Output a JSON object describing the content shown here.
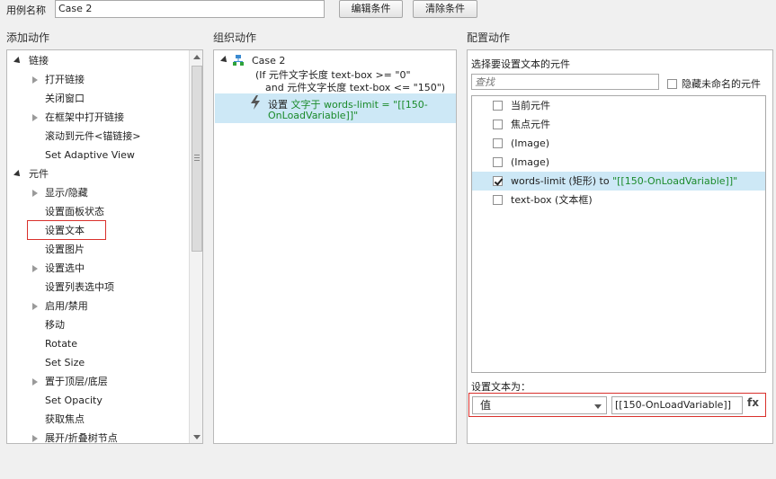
{
  "top": {
    "case_name_label": "用例名称",
    "case_name_value": "Case 2",
    "edit_condition_button": "编辑条件",
    "clear_condition_button": "清除条件"
  },
  "left": {
    "title": "添加动作",
    "items": [
      {
        "label": "链接",
        "kind": "group"
      },
      {
        "label": "打开链接",
        "kind": "sub"
      },
      {
        "label": "关闭窗口",
        "kind": "leaf"
      },
      {
        "label": "在框架中打开链接",
        "kind": "sub"
      },
      {
        "label": "滚动到元件<锚链接>",
        "kind": "leaf"
      },
      {
        "label": "Set Adaptive View",
        "kind": "leaf"
      },
      {
        "label": "元件",
        "kind": "group"
      },
      {
        "label": "显示/隐藏",
        "kind": "sub"
      },
      {
        "label": "设置面板状态",
        "kind": "leaf"
      },
      {
        "label": "设置文本",
        "kind": "leaf",
        "selected": true
      },
      {
        "label": "设置图片",
        "kind": "leaf"
      },
      {
        "label": "设置选中",
        "kind": "sub"
      },
      {
        "label": "设置列表选中项",
        "kind": "leaf"
      },
      {
        "label": "启用/禁用",
        "kind": "sub"
      },
      {
        "label": "移动",
        "kind": "leaf"
      },
      {
        "label": "Rotate",
        "kind": "leaf"
      },
      {
        "label": "Set Size",
        "kind": "leaf"
      },
      {
        "label": "置于顶层/底层",
        "kind": "sub"
      },
      {
        "label": "Set Opacity",
        "kind": "leaf"
      },
      {
        "label": "获取焦点",
        "kind": "leaf"
      },
      {
        "label": "展开/折叠树节点",
        "kind": "sub"
      }
    ]
  },
  "middle": {
    "title": "组织动作",
    "case_title": "Case 2",
    "condition_line1": "(If 元件文字长度 text-box >= \"0\"",
    "condition_line2": "and 元件文字长度 text-box <= \"150\")",
    "action_prefix": "设置",
    "action_line1": "文字于 words-limit = \"[[150-",
    "action_line2": "OnLoadVariable]]\""
  },
  "right": {
    "title": "配置动作",
    "select_label": "选择要设置文本的元件",
    "search_placeholder": "查找",
    "hide_unnamed_label": "隐藏未命名的元件",
    "widgets": [
      {
        "label": "当前元件",
        "checked": false
      },
      {
        "label": "焦点元件",
        "checked": false
      },
      {
        "label": "(Image)",
        "checked": false
      },
      {
        "label": "(Image)",
        "checked": false
      },
      {
        "label_pre": "words-limit (矩形) to ",
        "label_value": "\"[[150-OnLoadVariable]]\"",
        "checked": true,
        "selected": true
      },
      {
        "label": "text-box (文本框)",
        "checked": false
      }
    ],
    "set_text_label": "设置文本为：",
    "type_select_value": "值",
    "value_input": "[[150-OnLoadVariable]]",
    "fx_label": "fx"
  }
}
